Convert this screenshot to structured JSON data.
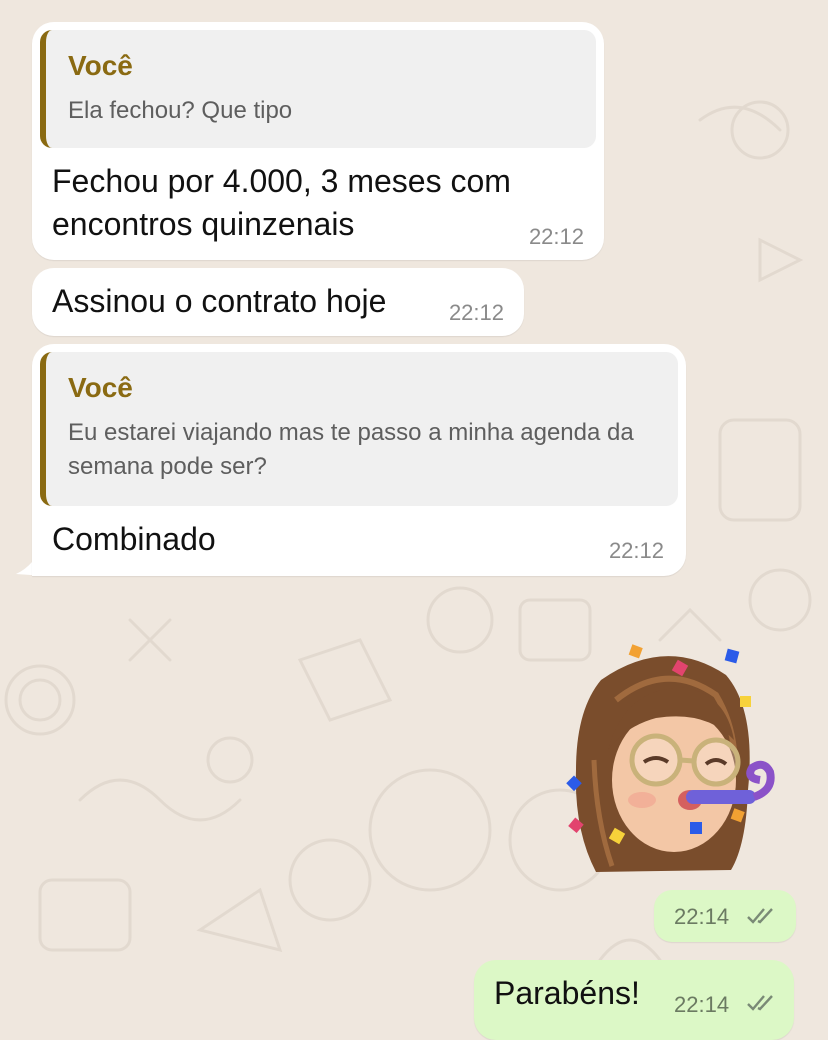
{
  "chat": {
    "messages": [
      {
        "quote": {
          "author": "Você",
          "text": "Ela fechou? Que tipo"
        },
        "text": "Fechou por 4.000, 3 meses com encontros quinzenais",
        "time": "22:12"
      },
      {
        "text": "Assinou o contrato hoje",
        "time": "22:12"
      },
      {
        "quote": {
          "author": "Você",
          "text": "Eu estarei viajando mas te passo a minha agenda da semana pode ser?"
        },
        "text": "Combinado",
        "time": "22:12"
      },
      {
        "sticker": "memoji-party-horn-sticker",
        "time": "22:14",
        "status": "read"
      },
      {
        "text": "Parabéns!",
        "time": "22:14",
        "status": "read"
      }
    ]
  },
  "colors": {
    "wallpaper": "#efe7de",
    "incoming_bubble": "#ffffff",
    "outgoing_bubble": "#dcf8c6",
    "quote_author": "#8a6a12",
    "quote_bar": "#8a6a12",
    "time_text": "#8a8a8a"
  }
}
